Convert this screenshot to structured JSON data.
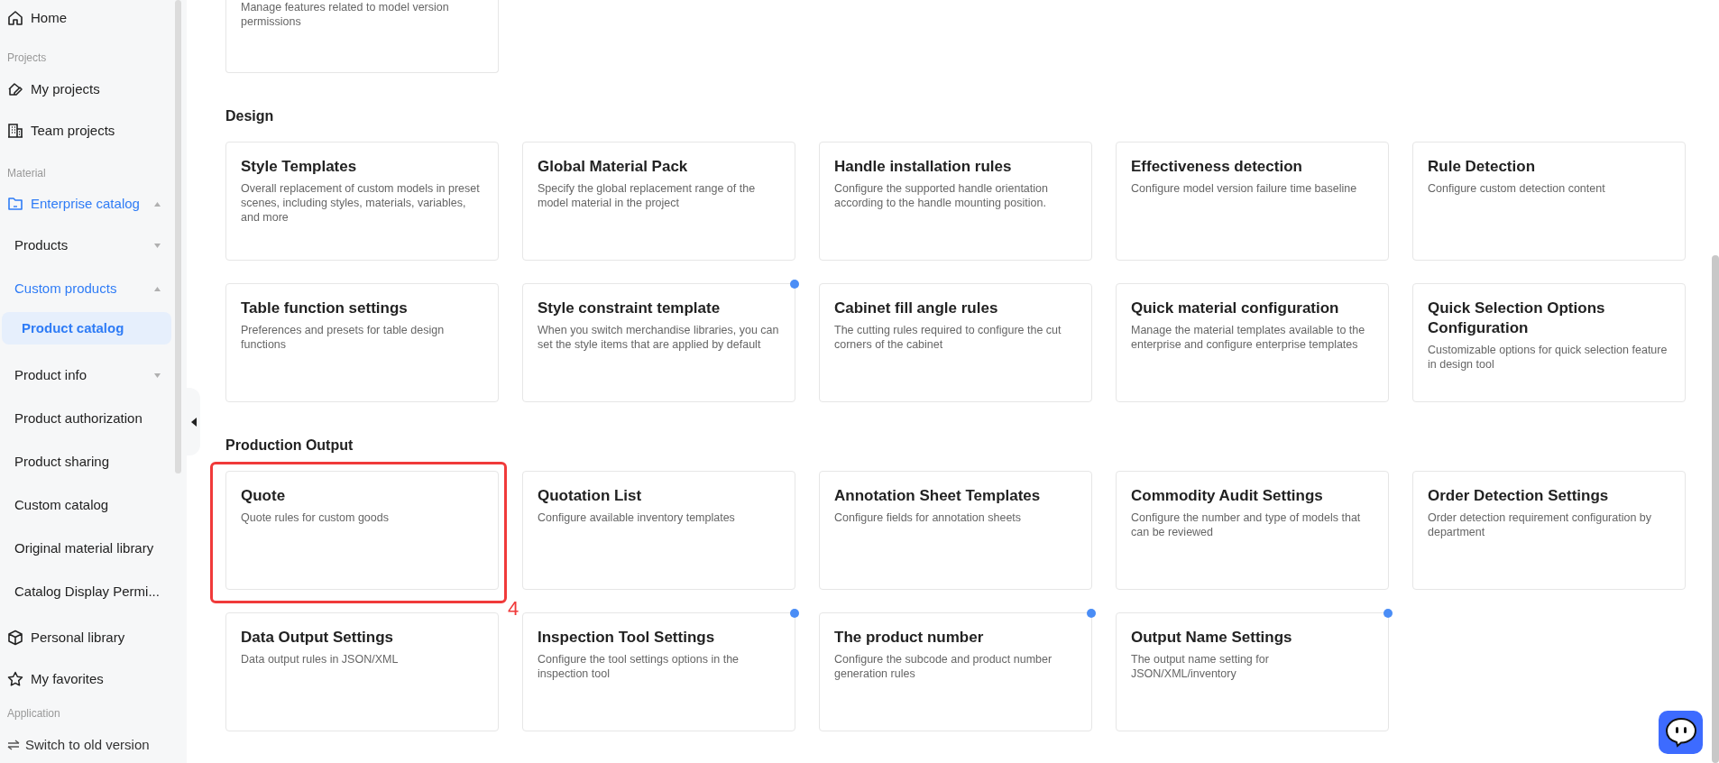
{
  "sidebar": {
    "items": [
      {
        "kind": "link",
        "label": "Home",
        "selected": false
      },
      {
        "kind": "section",
        "label": "Projects"
      },
      {
        "kind": "link",
        "label": "My projects",
        "selected": false
      },
      {
        "kind": "link",
        "label": "Team projects",
        "selected": false
      },
      {
        "kind": "section",
        "label": "Material"
      },
      {
        "kind": "group",
        "label": "Enterprise catalog",
        "expanded": true,
        "children": [
          {
            "label": "Products",
            "selected": false,
            "expanded": false
          },
          {
            "label": "Custom products",
            "selected": false,
            "expanded": true,
            "children": [
              {
                "label": "Product catalog",
                "selected": true
              }
            ]
          },
          {
            "label": "Product info",
            "selected": false,
            "expanded": false
          },
          {
            "label": "Product authorization",
            "selected": false
          },
          {
            "label": "Product sharing",
            "selected": false
          },
          {
            "label": "Custom catalog",
            "selected": false
          },
          {
            "label": "Original material library",
            "selected": false
          },
          {
            "label": "Catalog Display Permi...",
            "selected": false
          }
        ]
      },
      {
        "kind": "link",
        "label": "Personal library",
        "selected": false
      },
      {
        "kind": "link",
        "label": "My favorites",
        "selected": false
      },
      {
        "kind": "section",
        "label": "Application"
      }
    ],
    "footer": "Switch to old version"
  },
  "sections": [
    {
      "cards": [
        {
          "description": "Manage features related to model version permissions",
          "dot": false
        }
      ]
    },
    {
      "title": "Design",
      "cards": [
        {
          "title": "Style Templates",
          "description": "Overall replacement of custom models in preset scenes, including styles, materials, variables, and more",
          "dot": false
        },
        {
          "title": "Global Material Pack",
          "description": "Specify the global replacement range of the model material in the project",
          "dot": false
        },
        {
          "title": "Handle installation rules",
          "description": "Configure the supported handle orientation according to the handle mounting position.",
          "dot": false
        },
        {
          "title": "Effectiveness detection",
          "description": "Configure model version failure time baseline",
          "dot": false
        },
        {
          "title": "Rule Detection",
          "description": "Configure custom detection content",
          "dot": false
        },
        {
          "title": "Table function settings",
          "description": "Preferences and presets for table design functions",
          "dot": false
        },
        {
          "title": "Style constraint template",
          "description": "When you switch merchandise libraries, you can set the style items that are applied by default",
          "dot": true
        },
        {
          "title": "Cabinet fill angle rules",
          "description": "The cutting rules required to configure the cut corners of the cabinet",
          "dot": false
        },
        {
          "title": "Quick material configuration",
          "description": "Manage the material templates available to the enterprise and configure enterprise templates",
          "dot": false
        },
        {
          "title": "Quick Selection Options Configuration",
          "description": "Customizable options for quick selection feature in design tool",
          "dot": false
        }
      ]
    },
    {
      "title": "Production Output",
      "cards": [
        {
          "title": "Quote",
          "description": "Quote rules for custom goods",
          "dot": false,
          "highlighted": true,
          "annotation": "4"
        },
        {
          "title": "Quotation List",
          "description": "Configure available inventory templates",
          "dot": false
        },
        {
          "title": "Annotation Sheet Templates",
          "description": "Configure fields for annotation sheets",
          "dot": false
        },
        {
          "title": "Commodity Audit Settings",
          "description": "Configure the number and type of models that can be reviewed",
          "dot": false
        },
        {
          "title": "Order Detection Settings",
          "description": "Order detection requirement configuration by department",
          "dot": false
        },
        {
          "title": "Data Output Settings",
          "description": "Data output rules in JSON/XML",
          "dot": false
        },
        {
          "title": "Inspection Tool Settings",
          "description": "Configure the tool settings options in the inspection tool",
          "dot": true
        },
        {
          "title": "The product number",
          "description": "Configure the subcode and product number generation rules",
          "dot": true
        },
        {
          "title": "Output Name Settings",
          "description": "The output name setting for JSON/XML/inventory",
          "dot": true
        }
      ]
    }
  ]
}
